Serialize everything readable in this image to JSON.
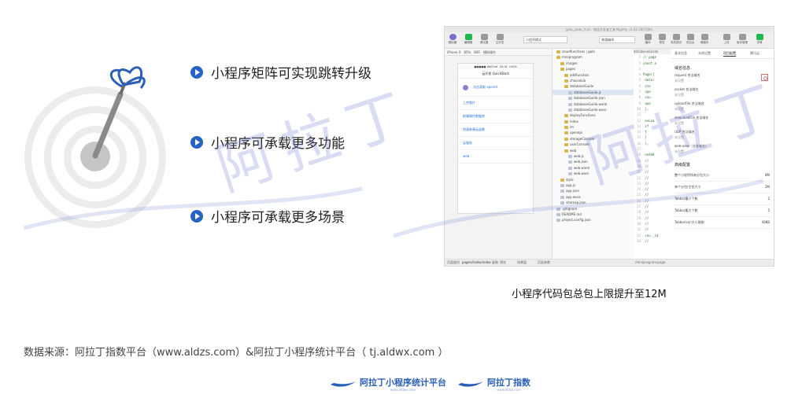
{
  "bullets": [
    {
      "text": "小程序矩阵可实现跳转升级"
    },
    {
      "text": "小程序可承载更多功能"
    },
    {
      "text": "小程序可承载更多场景"
    }
  ],
  "watermark": {
    "text": "阿拉丁"
  },
  "ide": {
    "window_title": "gala_plate_fruit - 微信开发者工具 Nightly v1.02.1907083",
    "toolbar": {
      "left_buttons": [
        "模拟器",
        "编辑器",
        "调试器",
        "云开发"
      ],
      "mode_select": "小程序模式",
      "compile_select": "普通编译",
      "middle_buttons": [
        "编译",
        "预览",
        "真机调试",
        "切后台",
        "清缓存"
      ],
      "right_buttons": [
        "上传",
        "版本管理",
        "详情"
      ]
    },
    "simulator_bar": {
      "device": "iPhone X",
      "zoom": "85%",
      "network": "WiFi",
      "action": "模拟操作"
    },
    "phone": {
      "status_left": "●●●●● WeChat",
      "status_time": "16:16",
      "status_right": "100%",
      "nav_title": "云开发 QuickStart",
      "user_label": "点击获取 openid",
      "items": [
        "上传图片",
        "前端操作数据库",
        "快速新建云函数",
        "云服务",
        "web"
      ]
    },
    "tree": [
      {
        "label": "cloudfunctions | gala",
        "indent": 1,
        "kind": "folder"
      },
      {
        "label": "miniprogram",
        "indent": 1,
        "kind": "folder"
      },
      {
        "label": "images",
        "indent": 2,
        "kind": "folder"
      },
      {
        "label": "pages",
        "indent": 2,
        "kind": "folder"
      },
      {
        "label": "addFunction",
        "indent": 3,
        "kind": "folder"
      },
      {
        "label": "chooseLib",
        "indent": 3,
        "kind": "folder"
      },
      {
        "label": "databaseGuide",
        "indent": 3,
        "kind": "folder"
      },
      {
        "label": "databaseGuide.js",
        "indent": 4,
        "kind": "file",
        "selected": true
      },
      {
        "label": "databaseGuide.json",
        "indent": 4,
        "kind": "file"
      },
      {
        "label": "databaseGuide.wxml",
        "indent": 4,
        "kind": "file"
      },
      {
        "label": "databaseGuide.wxss",
        "indent": 4,
        "kind": "file"
      },
      {
        "label": "deployFunctions",
        "indent": 3,
        "kind": "folder"
      },
      {
        "label": "index",
        "indent": 3,
        "kind": "folder"
      },
      {
        "label": "im",
        "indent": 3,
        "kind": "folder"
      },
      {
        "label": "openapi",
        "indent": 3,
        "kind": "folder"
      },
      {
        "label": "storageConsole",
        "indent": 3,
        "kind": "folder"
      },
      {
        "label": "userConsole",
        "indent": 3,
        "kind": "folder"
      },
      {
        "label": "web",
        "indent": 3,
        "kind": "folder"
      },
      {
        "label": "web.js",
        "indent": 4,
        "kind": "file"
      },
      {
        "label": "web.json",
        "indent": 4,
        "kind": "file"
      },
      {
        "label": "web.wxml",
        "indent": 4,
        "kind": "file"
      },
      {
        "label": "web.wxss",
        "indent": 4,
        "kind": "file"
      },
      {
        "label": "style",
        "indent": 2,
        "kind": "folder"
      },
      {
        "label": "app.js",
        "indent": 2,
        "kind": "file"
      },
      {
        "label": "app.json",
        "indent": 2,
        "kind": "file"
      },
      {
        "label": "app.wxss",
        "indent": 2,
        "kind": "file"
      },
      {
        "label": "sitemap.json",
        "indent": 2,
        "kind": "file"
      },
      {
        "label": ".gitignore",
        "indent": 1,
        "kind": "file"
      },
      {
        "label": "README.md",
        "indent": 1,
        "kind": "file"
      },
      {
        "label": "project.config.json",
        "indent": 1,
        "kind": "file"
      }
    ],
    "code_header": "databaseGuide",
    "code_lines": [
      {
        "n": "1",
        "t": "// page"
      },
      {
        "n": "2",
        "t": "const a"
      },
      {
        "n": "3",
        "t": ""
      },
      {
        "n": "4",
        "t": "Page({"
      },
      {
        "n": "5",
        "t": "  data:"
      },
      {
        "n": "6",
        "t": "    ste"
      },
      {
        "n": "7",
        "t": "    ope"
      },
      {
        "n": "8",
        "t": "    cou"
      },
      {
        "n": "9",
        "t": "    que"
      },
      {
        "n": "10",
        "t": "  },"
      },
      {
        "n": "11",
        "t": ""
      },
      {
        "n": "12",
        "t": "  onLoa"
      },
      {
        "n": "13",
        "t": "    if"
      },
      {
        "n": "14",
        "t": "    t"
      },
      {
        "n": "15",
        "t": "    }"
      },
      {
        "n": "16",
        "t": "  },"
      },
      {
        "n": "17",
        "t": ""
      },
      {
        "n": "18",
        "t": "  onAdd"
      },
      {
        "n": "19",
        "t": "    //"
      },
      {
        "n": "20",
        "t": "    //"
      },
      {
        "n": "21",
        "t": "    //"
      },
      {
        "n": "22",
        "t": "    //"
      },
      {
        "n": "23",
        "t": "    //"
      },
      {
        "n": "24",
        "t": "    //"
      },
      {
        "n": "25",
        "t": "    //"
      },
      {
        "n": "26",
        "t": "    //"
      },
      {
        "n": "27",
        "t": "    //"
      },
      {
        "n": "28",
        "t": "    //"
      },
      {
        "n": "29",
        "t": "    //"
      },
      {
        "n": "30",
        "t": "    //"
      },
      {
        "n": "31",
        "t": "    //"
      },
      {
        "n": "32",
        "t": "    res._id"
      },
      {
        "n": "33",
        "t": "    //"
      }
    ],
    "code_footer": "/miniprogram/page",
    "panel": {
      "tabs": [
        "基本信息",
        "本地设置",
        "项目配置",
        "腾讯云"
      ],
      "active_tab": 2,
      "domain_title": "域名信息",
      "domains": [
        {
          "k": "request 合法域名",
          "v": "未设置"
        },
        {
          "k": "socket 合法域名",
          "v": "未设置"
        },
        {
          "k": "uploadFile 合法域名",
          "v": "未设置"
        },
        {
          "k": "downloadFile 合法域名",
          "v": "未设置"
        },
        {
          "k": "UDP 合法域名",
          "v": "未设置"
        },
        {
          "k": "web-view（业务域名）",
          "v": "未设置"
        }
      ],
      "advanced_title": "高级配置",
      "advanced": [
        {
          "k": "整个小程序所有分包大小",
          "v": "8M"
        },
        {
          "k": "单个分包/主包大小",
          "v": "2M"
        },
        {
          "k": "Tabbar最少个数",
          "v": "2"
        },
        {
          "k": "Tabbar最大个数",
          "v": "5"
        },
        {
          "k": "TabbarIcon大小限制",
          "v": "40KB"
        }
      ]
    },
    "statusbar": {
      "path": "页面路径",
      "page": "pages/index/index",
      "copy": "复制",
      "preview": "预览",
      "params": "场景值",
      "options": "页面参数"
    }
  },
  "caption": "小程序代码包总包上限提升至12M",
  "source": "数据来源：阿拉丁指数平台（www.aldzs.com）&阿拉丁小程序统计平台（ tj.aldwx.com ）",
  "footer": {
    "logo1": {
      "text": "阿拉丁小程序统计平台",
      "sub": "www.aldwx.com"
    },
    "logo2": {
      "text": "阿拉丁指数",
      "sub": "www.aldzs.com"
    }
  },
  "colors": {
    "bullet": "#2563c4",
    "brand": "#2a5fb8",
    "watermark": "#7882d2"
  }
}
